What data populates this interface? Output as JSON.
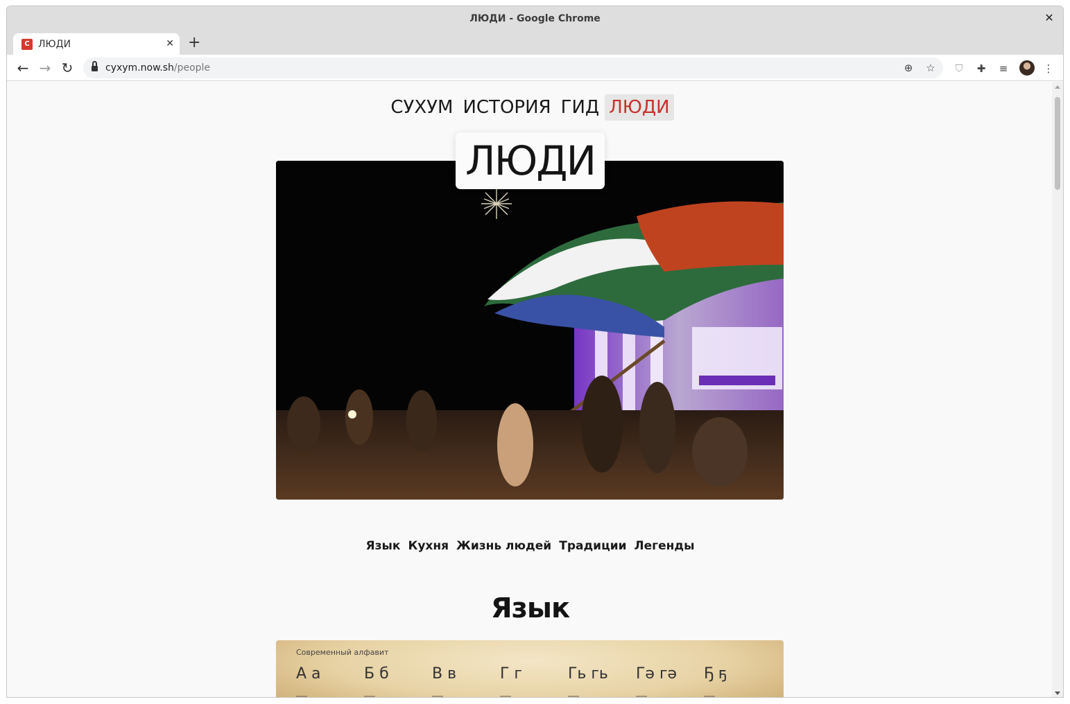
{
  "window": {
    "title": "ЛЮДИ - Google Chrome",
    "close_glyph": "✕"
  },
  "tabs": [
    {
      "favicon_letter": "С",
      "label": "ЛЮДИ",
      "close_glyph": "✕"
    }
  ],
  "new_tab_glyph": "+",
  "toolbar": {
    "back_glyph": "←",
    "forward_glyph": "→",
    "reload_glyph": "↻",
    "url_host": "cyxym.now.sh",
    "url_path": "/people",
    "install_glyph": "⊕",
    "bookmark_glyph": "☆",
    "shield_glyph": "⛉",
    "extensions_glyph": "✚",
    "media_glyph": "≡",
    "menu_glyph": "⋮"
  },
  "site": {
    "nav": [
      {
        "label": "СУХУМ",
        "active": false
      },
      {
        "label": "ИСТОРИЯ",
        "active": false
      },
      {
        "label": "ГИД",
        "active": false
      },
      {
        "label": "ЛЮДИ",
        "active": true
      }
    ],
    "hero_title": "ЛЮДИ",
    "subnav": [
      "Язык",
      "Кухня",
      "Жизнь людей",
      "Традиции",
      "Легенды"
    ],
    "section_title": "Язык",
    "alphabet": {
      "caption": "Современный алфавит",
      "letters": [
        "А а",
        "Б б",
        "В в",
        "Г г",
        "Гь гь",
        "Гә гә",
        "Ҕ ҕ"
      ]
    }
  },
  "colors": {
    "accent_red": "#c8312b",
    "active_nav_bg": "#e6e6e6",
    "page_bg": "#f9f9f9"
  }
}
